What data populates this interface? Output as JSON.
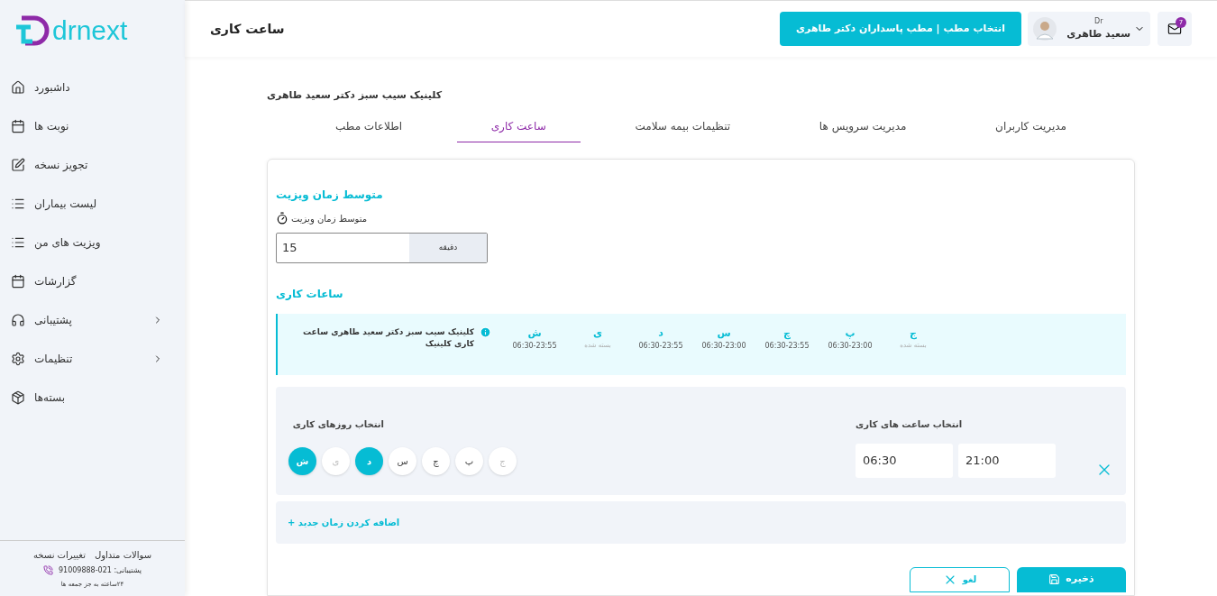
{
  "logo": {
    "text": "drnext"
  },
  "sidebar": {
    "items": [
      {
        "label": "داشبورد",
        "expandable": false
      },
      {
        "label": "نوبت ها",
        "expandable": false
      },
      {
        "label": "تجویز نسخه",
        "expandable": false
      },
      {
        "label": "لیست بیماران",
        "expandable": false
      },
      {
        "label": "ویزیت های من",
        "expandable": false
      },
      {
        "label": "گزارشات",
        "expandable": false
      },
      {
        "label": "پشتیبانی",
        "expandable": true
      },
      {
        "label": "تنظیمات",
        "expandable": true
      },
      {
        "label": "بسته‌ها",
        "expandable": false
      }
    ],
    "footer": {
      "links": [
        "سوالات متداول",
        "تغییرات نسخه"
      ],
      "support": "پشتیبانی: 021-91009888",
      "hours": "۲۴ساعته به جز جمعه ها"
    }
  },
  "header": {
    "title": "ساعت کاری",
    "clinic_button": "انتخاب مطب | مطب پاسداران دکتر طاهری",
    "user": {
      "prefix": "Dr",
      "name": "سعید طاهری"
    },
    "messages_badge": "7"
  },
  "clinic_name": "کلینیک سیب سبز دکتر سعید طاهری",
  "tabs": [
    {
      "label": "مدیریت کاربران",
      "selected": false
    },
    {
      "label": "مدیریت سرویس ها",
      "selected": false
    },
    {
      "label": "تنظیمات بیمه سلامت",
      "selected": false
    },
    {
      "label": "ساعت کاری",
      "selected": true
    },
    {
      "label": "اطلاعات مطب",
      "selected": false
    }
  ],
  "visit_time": {
    "heading": "متوسط زمان ویزیت",
    "label": "متوسط زمان ویزیت",
    "value": "15",
    "unit": "دقیقه"
  },
  "work_hours": {
    "heading": "ساعات کاری",
    "summary": {
      "text": "کلینیک سیب سبز دکتر سعید طاهری ساعت کاری کلینیک",
      "days": [
        {
          "day": "ج",
          "hours": "بسته شده",
          "closed": true
        },
        {
          "day": "پ",
          "hours": "06:30-23:00",
          "closed": false
        },
        {
          "day": "چ",
          "hours": "06:30-23:55",
          "closed": false
        },
        {
          "day": "س",
          "hours": "06:30-23:00",
          "closed": false
        },
        {
          "day": "د",
          "hours": "06:30-23:55",
          "closed": false
        },
        {
          "day": "ی",
          "hours": "بسته شده",
          "closed": true
        },
        {
          "day": "ش",
          "hours": "06:30-23:55",
          "closed": false
        }
      ]
    },
    "slot": {
      "days_label": "انتخاب روزهای کاری",
      "hours_label": "انتخاب ساعت های کاری",
      "from": "06:30",
      "to": "21:00",
      "days": [
        {
          "day": "ج",
          "selected": false,
          "disabled": true
        },
        {
          "day": "پ",
          "selected": false,
          "disabled": false
        },
        {
          "day": "چ",
          "selected": false,
          "disabled": false
        },
        {
          "day": "س",
          "selected": false,
          "disabled": false
        },
        {
          "day": "د",
          "selected": true,
          "disabled": false
        },
        {
          "day": "ی",
          "selected": false,
          "disabled": true
        },
        {
          "day": "ش",
          "selected": true,
          "disabled": false
        }
      ]
    },
    "add_label": "اضافه کردن زمان جدید +"
  },
  "buttons": {
    "cancel": "لغو",
    "save": "ذخیره"
  }
}
